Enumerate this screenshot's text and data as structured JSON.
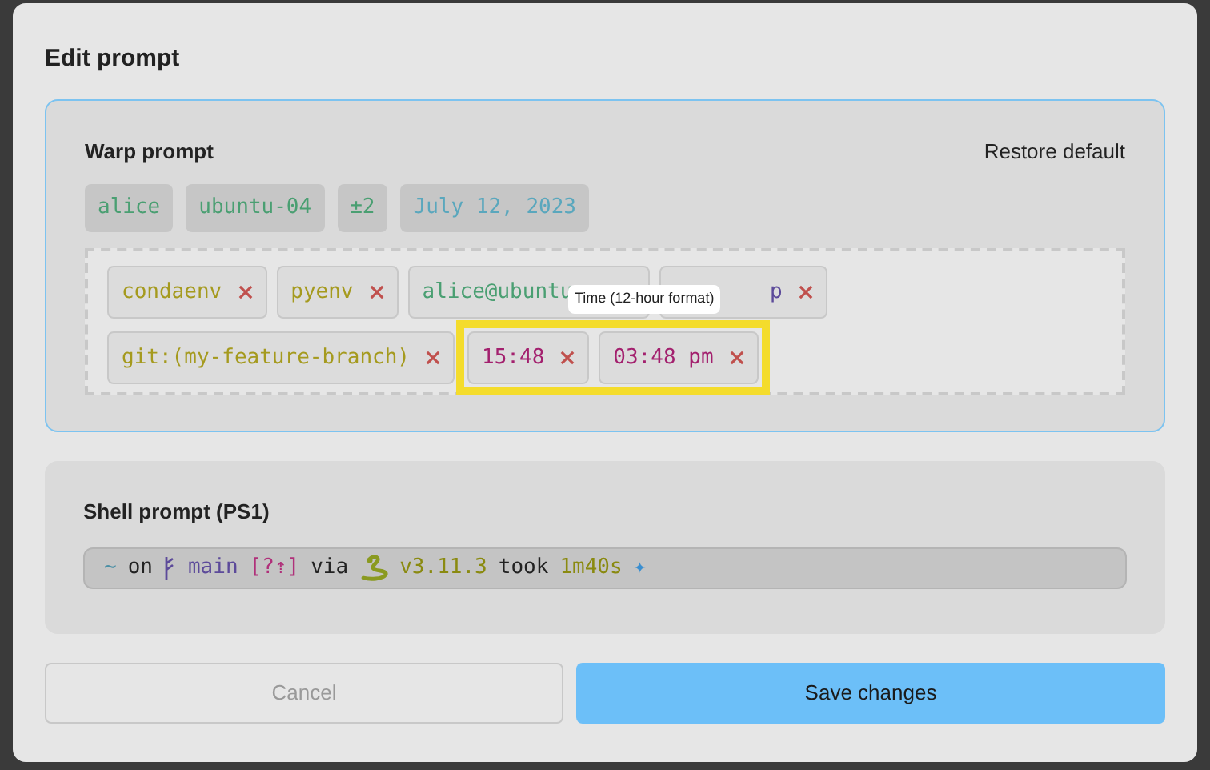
{
  "dialog": {
    "title": "Edit prompt"
  },
  "warp_prompt": {
    "title": "Warp prompt",
    "restore_link": "Restore default",
    "preview": [
      {
        "text": "alice",
        "color": "#4a9f72"
      },
      {
        "text": "ubuntu-04",
        "color": "#4a9f72"
      },
      {
        "text": "±2",
        "color": "#4a9f72"
      },
      {
        "text": "July 12, 2023",
        "color": "#5aa7bd"
      }
    ],
    "chips": [
      {
        "text": "condaenv",
        "color": "#a59a1e",
        "highlighted": false,
        "remove_icon": true
      },
      {
        "text": "pyenv",
        "color": "#a59a1e",
        "highlighted": false,
        "remove_icon": true
      },
      {
        "text": "alice@ubuntu",
        "color": "#4a9f72",
        "highlighted": false,
        "remove_icon": false
      },
      {
        "text": "p",
        "color": "#5c4a9a",
        "highlighted": false,
        "remove_icon": true
      },
      {
        "text": "git:(my-feature-branch)",
        "color": "#a59a1e",
        "highlighted": false,
        "remove_icon": true
      },
      {
        "text": "15:48",
        "color": "#a3206e",
        "highlighted": true,
        "remove_icon": true
      },
      {
        "text": "03:48 pm",
        "color": "#a3206e",
        "highlighted": true,
        "remove_icon": true
      }
    ],
    "tooltip": "Time (12-hour format)"
  },
  "shell_prompt": {
    "title": "Shell prompt (PS1)",
    "segments": [
      {
        "kind": "text",
        "text": "~",
        "color": "#4a8fa5"
      },
      {
        "kind": "text",
        "text": "on",
        "color": "#222222"
      },
      {
        "kind": "branch-icon",
        "color": "#5c4a9a"
      },
      {
        "kind": "text",
        "text": "main",
        "color": "#5c4a9a"
      },
      {
        "kind": "text",
        "text": "[?⇡]",
        "color": "#b0307a"
      },
      {
        "kind": "text",
        "text": "via",
        "color": "#222222"
      },
      {
        "kind": "snake-icon",
        "color": "#8a9a20"
      },
      {
        "kind": "text",
        "text": "v3.11.3",
        "color": "#8a8a10"
      },
      {
        "kind": "text",
        "text": "took",
        "color": "#222222"
      },
      {
        "kind": "text",
        "text": "1m40s",
        "color": "#8a8a10"
      },
      {
        "kind": "text",
        "text": "✦",
        "color": "#3b8fd0"
      }
    ]
  },
  "buttons": [
    {
      "label": "Cancel",
      "kind": "secondary"
    },
    {
      "label": "Save changes",
      "kind": "primary"
    }
  ]
}
